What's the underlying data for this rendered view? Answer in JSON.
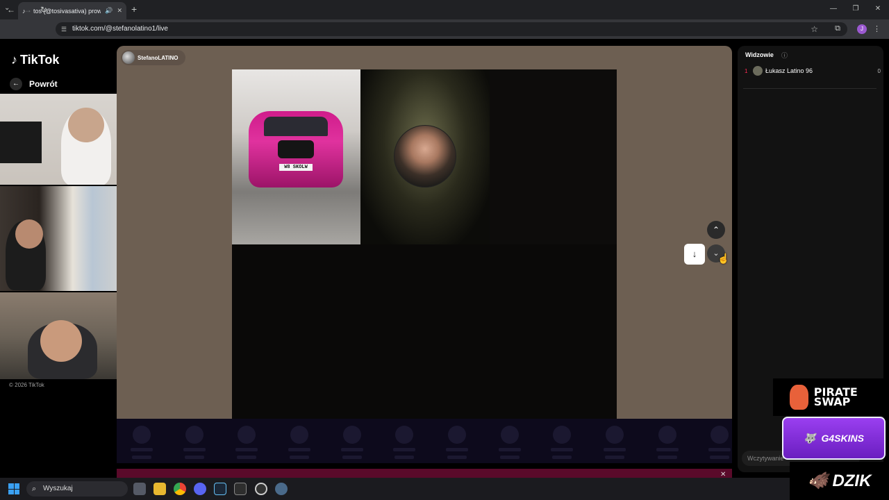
{
  "browser": {
    "tab_title": "tos (@tosivasativa) prowadz",
    "url": "tiktok.com/@stefanolatino1/live",
    "profile_initial": "J"
  },
  "tiktok": {
    "logo": "TikTok",
    "back_label": "Powrót",
    "copyright": "© 2026 TikTok",
    "host_name": "StefanoLATINO",
    "viewers_title": "Widzowie",
    "viewers": [
      {
        "rank": "1",
        "name": "Łukasz Latino 96",
        "score": "0"
      }
    ],
    "chat_placeholder": "Wczytywanie"
  },
  "stream_overlays": {
    "plate": "W8 SKOLW",
    "sponsor1": "PIRATE SWAP",
    "sponsor2": "G4SKINS",
    "sponsor3": "DZIK"
  },
  "taskbar": {
    "search_placeholder": "Wyszukaj"
  },
  "colors": {
    "stage_bg": "#6d5f52",
    "accent": "#fe2c55"
  }
}
